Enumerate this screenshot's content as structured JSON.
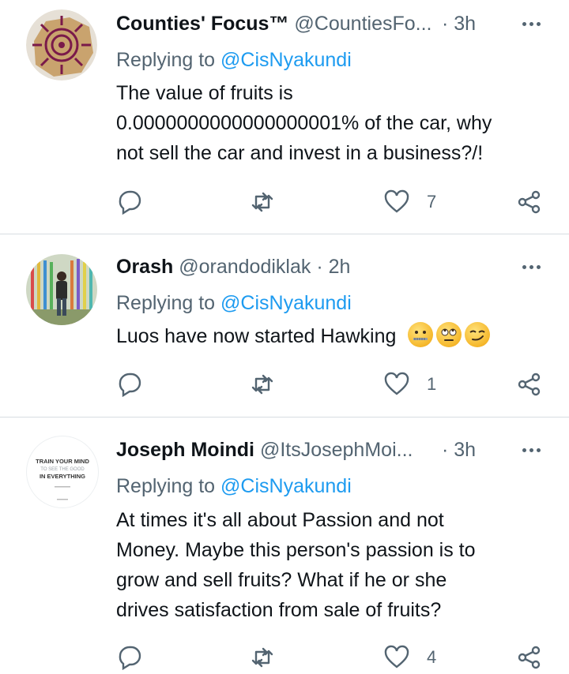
{
  "tweets": [
    {
      "name": "Counties' Focus™",
      "handle": "@CountiesFo...",
      "time": "· 3h",
      "reply_prefix": "Replying to ",
      "reply_to": "@CisNyakundi",
      "text_lines": [
        "The value of fruits is",
        "0.0000000000000000001% of the car, why",
        "not sell the car and invest in a business?/!"
      ],
      "likes": "7",
      "avatar": "compass-logo"
    },
    {
      "name": "Orash",
      "handle": "@orandodiklak",
      "time": "· 2h",
      "reply_prefix": "Replying to ",
      "reply_to": "@CisNyakundi",
      "text_lines": [
        "Luos have now started Hawking"
      ],
      "emojis": [
        "zipper-mouth-face",
        "face-with-rolling-eyes",
        "smirking-face"
      ],
      "likes": "1",
      "avatar": "person-photo"
    },
    {
      "name": "Joseph Moindi",
      "handle": "@ItsJosephMoi...",
      "time": "· 3h",
      "reply_prefix": "Replying to ",
      "reply_to": "@CisNyakundi",
      "text_lines": [
        "At times it's all about Passion and not",
        "Money. Maybe this person's passion is to",
        "grow and sell fruits? What if he or she",
        "drives satisfaction from sale of fruits?"
      ],
      "likes": "4",
      "avatar": "text-quote-logo",
      "avatar_text": [
        "TRAIN YOUR MIND",
        "TO SEE THE GOOD",
        "IN EVERYTHING"
      ]
    }
  ],
  "colors": {
    "text": "#0f1419",
    "secondary": "#536471",
    "link": "#1d9bf0",
    "divider": "#d7dde2"
  },
  "icons": [
    "reply-icon",
    "retweet-icon",
    "like-icon",
    "share-icon",
    "more-icon"
  ]
}
